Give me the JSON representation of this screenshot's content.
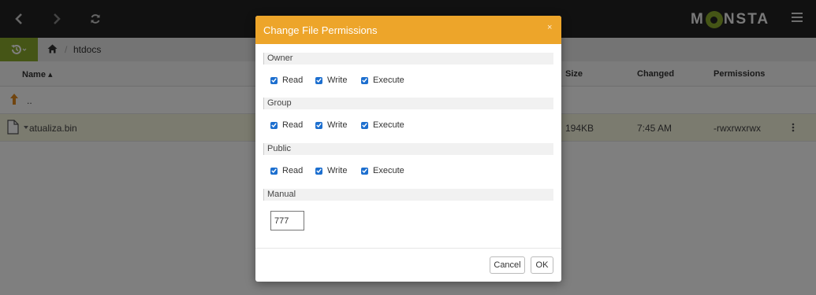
{
  "topbar": {
    "back_icon": "chevron-left-icon",
    "forward_icon": "chevron-right-icon",
    "refresh_icon": "refresh-icon",
    "logo_left": "M",
    "logo_right": "NSTA",
    "menu_icon": "hamburger-menu-icon"
  },
  "breadcrumb": {
    "history_icon": "history-icon",
    "home_icon": "home-icon",
    "separator": "/",
    "current": "htdocs"
  },
  "table": {
    "columns": {
      "name": "Name ▴",
      "size": "Size",
      "changed": "Changed",
      "permissions": "Permissions"
    },
    "parent_row": {
      "label": ".."
    },
    "files": [
      {
        "name": "atualiza.bin",
        "size": "194KB",
        "changed": "7:45 AM",
        "permissions": "-rwxrwxrwx"
      }
    ]
  },
  "dialog": {
    "title": "Change File Permissions",
    "close": "×",
    "groups": [
      {
        "label": "Owner",
        "read": "Read",
        "write": "Write",
        "execute": "Execute"
      },
      {
        "label": "Group",
        "read": "Read",
        "write": "Write",
        "execute": "Execute"
      },
      {
        "label": "Public",
        "read": "Read",
        "write": "Write",
        "execute": "Execute"
      }
    ],
    "manual_label": "Manual",
    "manual_value": "777",
    "cancel": "Cancel",
    "ok": "OK"
  },
  "colors": {
    "accent_green": "#8aaa2c",
    "dialog_header": "#eda52a",
    "checkbox": "#1d6fcf",
    "selected_row": "#f7f6df"
  }
}
